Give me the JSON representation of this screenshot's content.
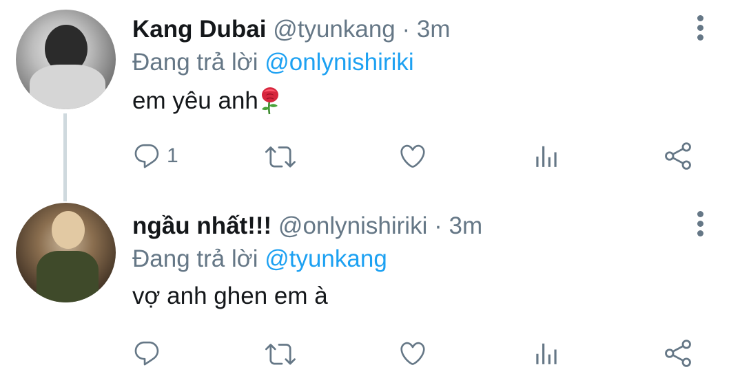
{
  "tweets": [
    {
      "name": "Kang Dubai",
      "handle": "@tyunkang",
      "separator": "·",
      "time": "3m",
      "reply_prefix": "Đang trả lời",
      "reply_to": "@onlynishiriki",
      "text": "em yêu anh",
      "emoji": "rose-emoji",
      "reply_count": "1"
    },
    {
      "name": "ngầu nhất!!!",
      "handle": "@onlynishiriki",
      "separator": "·",
      "time": "3m",
      "reply_prefix": "Đang trả lời",
      "reply_to": "@tyunkang",
      "text": "vợ anh ghen em à",
      "reply_count": ""
    }
  ],
  "icons": {
    "reply": "reply-icon",
    "retweet": "retweet-icon",
    "like": "heart-icon",
    "stats": "analytics-icon",
    "share": "share-icon",
    "more": "more-options-icon"
  },
  "colors": {
    "text": "#14171a",
    "secondary": "#657786",
    "mention": "#1da1f2",
    "thread_line": "#cfd9de"
  }
}
